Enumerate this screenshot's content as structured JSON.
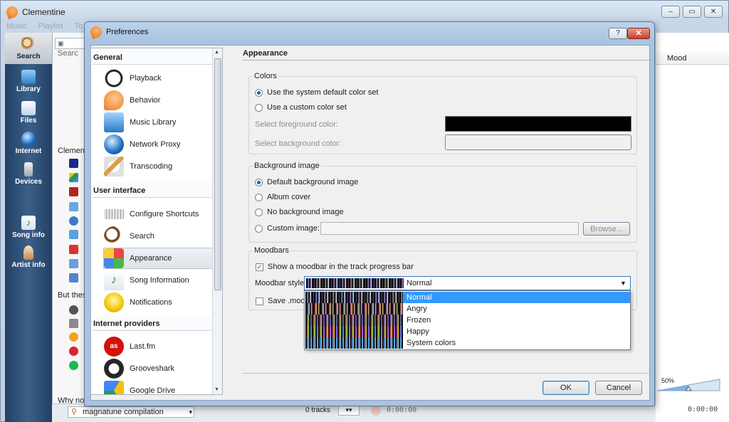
{
  "main_window": {
    "title": "Clementine",
    "menu": [
      "Music",
      "Playlist",
      "To"
    ],
    "search_placeholder": "Searc",
    "mood_column": "Mood",
    "volume": "50%",
    "time_right": "0:00:00",
    "track_count": "0 tracks",
    "time_mid": "0:00:00",
    "bottom_search": "magnatune compilation",
    "partial_text_1": "Clemen",
    "partial_text_2": "But thes",
    "partial_text_3": "Why not"
  },
  "sidebar": {
    "items": [
      {
        "label": "Search",
        "icon": "search-icon"
      },
      {
        "label": "Library",
        "icon": "library-icon"
      },
      {
        "label": "Files",
        "icon": "files-icon"
      },
      {
        "label": "Internet",
        "icon": "internet-icon"
      },
      {
        "label": "Devices",
        "icon": "devices-icon"
      },
      {
        "label": "Song info",
        "icon": "song-info-icon"
      },
      {
        "label": "Artist info",
        "icon": "artist-info-icon"
      }
    ]
  },
  "prefs": {
    "title": "Preferences",
    "help_label": "?",
    "close_label": "✕",
    "ok_label": "OK",
    "cancel_label": "Cancel",
    "categories": {
      "general_header": "General",
      "general": [
        "Playback",
        "Behavior",
        "Music Library",
        "Network Proxy",
        "Transcoding"
      ],
      "ui_header": "User interface",
      "ui": [
        "Configure Shortcuts",
        "Search",
        "Appearance",
        "Song Information",
        "Notifications"
      ],
      "providers_header": "Internet providers",
      "providers": [
        "Last.fm",
        "Grooveshark",
        "Google Drive"
      ]
    },
    "page": {
      "title": "Appearance",
      "colors": {
        "title": "Colors",
        "opt_system": "Use the system default color set",
        "opt_custom": "Use a custom color set",
        "fg_label": "Select foreground color:",
        "bg_label": "Select background color:",
        "fg_color": "#000000",
        "bg_color": "#f0f0f0"
      },
      "background": {
        "title": "Background image",
        "opt_default": "Default background image",
        "opt_album": "Album cover",
        "opt_none": "No background image",
        "opt_custom": "Custom image:",
        "browse": "Browse..."
      },
      "moodbars": {
        "title": "Moodbars",
        "show_label": "Show a moodbar in the track progress bar",
        "style_label": "Moodbar style",
        "selected": "Normal",
        "save_label": "Save .mood",
        "options": [
          "Normal",
          "Angry",
          "Frozen",
          "Happy",
          "System colors"
        ]
      }
    }
  }
}
